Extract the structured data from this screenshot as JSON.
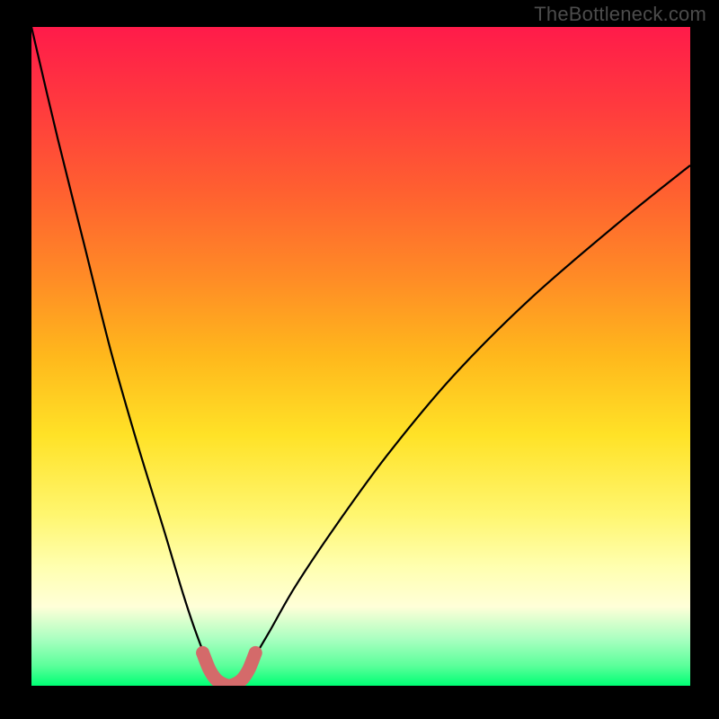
{
  "watermark": "TheBottleneck.com",
  "colors": {
    "background": "#000000",
    "gradient_top": "#ff1b4a",
    "gradient_mid": "#ffe227",
    "gradient_bottom": "#00ff74",
    "curve": "#000000",
    "accent_curve": "#d46a6a"
  },
  "chart_data": {
    "type": "line",
    "title": "",
    "xlabel": "",
    "ylabel": "",
    "xlim": [
      0,
      100
    ],
    "ylim": [
      0,
      100
    ],
    "series": [
      {
        "name": "bottleneck-curve",
        "x": [
          0,
          4,
          8,
          12,
          16,
          20,
          23,
          25,
          27,
          28.5,
          30,
          31.5,
          33,
          36,
          40,
          46,
          54,
          64,
          76,
          90,
          100
        ],
        "y": [
          100,
          83,
          67,
          51,
          37,
          24,
          14,
          8,
          3,
          1,
          0,
          1,
          3,
          8,
          15,
          24,
          35,
          47,
          59,
          71,
          79
        ]
      },
      {
        "name": "notch-accent",
        "x": [
          26,
          27,
          28,
          29,
          30,
          31,
          32,
          33,
          34
        ],
        "y": [
          5,
          2.5,
          1,
          0.3,
          0,
          0.3,
          1,
          2.5,
          5
        ]
      }
    ],
    "annotations": []
  }
}
